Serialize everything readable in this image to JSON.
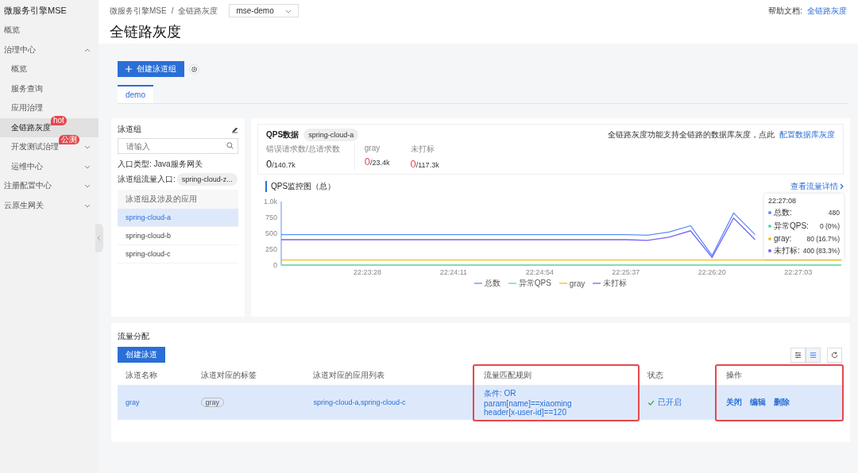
{
  "sidebar": {
    "title": "微服务引擎MSE",
    "items": [
      {
        "label": "概览",
        "selected": false
      },
      {
        "label": "治理中心",
        "selected": false,
        "expanded": true,
        "children": [
          {
            "label": "概览",
            "selected": false
          },
          {
            "label": "服务查询",
            "selected": false
          },
          {
            "label": "应用治理",
            "selected": false
          },
          {
            "label": "全链路灰度",
            "selected": true,
            "badge": "hot"
          },
          {
            "label": "开发测试治理",
            "selected": false,
            "badge": "公测",
            "expanded": false
          },
          {
            "label": "运维中心",
            "selected": false,
            "expanded": false
          }
        ]
      },
      {
        "label": "注册配置中心",
        "selected": false,
        "expanded": false
      },
      {
        "label": "云原生网关",
        "selected": false,
        "expanded": false
      }
    ]
  },
  "breadcrumb": {
    "items": [
      "微服务引擎MSE",
      "全链路灰度"
    ],
    "separator": "/"
  },
  "instance_select": {
    "value": "mse-demo"
  },
  "help": {
    "label": "帮助文档:",
    "link": "全链路灰度"
  },
  "page_title": "全链路灰度",
  "create_group_button": "创建泳道组",
  "tabs": [
    {
      "label": "demo",
      "selected": true
    }
  ],
  "lane_group": {
    "title": "泳道组",
    "search": {
      "placeholder": "请输入"
    },
    "entry_type": "入口类型: Java服务网关",
    "entry_label": "泳道组流量入口:",
    "entry_value": "spring-cloud-z...",
    "apps_header": "泳道组及涉及的应用",
    "apps": [
      {
        "label": "spring-cloud-a",
        "selected": true
      },
      {
        "label": "spring-cloud-b",
        "selected": false
      },
      {
        "label": "spring-cloud-c",
        "selected": false
      }
    ]
  },
  "qps": {
    "title": "QPS数据",
    "app": "spring-cloud-a",
    "notice": "全链路灰度功能支持全链路的数据库灰度，点此",
    "notice_link": "配置数据库灰度",
    "stats": [
      {
        "label": "错误请求数/总请求数",
        "value": "0",
        "total": "/140.7k",
        "alert": false
      },
      {
        "label": "gray",
        "value": "0",
        "total": "/23.4k",
        "alert": true
      },
      {
        "label": "未打标",
        "value": "0",
        "total": "/117.3k",
        "alert": true
      }
    ]
  },
  "monitor": {
    "title": "QPS监控图（总）",
    "detail_link": "查看流量详情",
    "chart_data": {
      "type": "line",
      "categories": [
        null,
        null,
        null,
        null,
        "22:23:28",
        null,
        null,
        null,
        "22:24:11",
        null,
        null,
        null,
        "22:24:54",
        null,
        null,
        null,
        "22:25:37",
        null,
        null,
        null,
        "22:26:20",
        null,
        null,
        null,
        "22:27:03",
        null,
        null
      ],
      "ylim": [
        0,
        1000
      ],
      "legend": true,
      "yticks": [
        0,
        250,
        500,
        750,
        {
          "value": 1000,
          "label": "1.0k"
        }
      ],
      "series": [
        {
          "name": "总数",
          "color": "#5b8ff9",
          "values": [
            480,
            480,
            480,
            480,
            480,
            480,
            480,
            480,
            480,
            480,
            480,
            480,
            480,
            480,
            480,
            480,
            480,
            470,
            520,
            620,
            150,
            820,
            480,
            null,
            null,
            null,
            null
          ]
        },
        {
          "name": "异常QPS",
          "color": "#5ad8a6",
          "values": [
            0,
            0,
            0,
            0,
            0,
            0,
            0,
            0,
            0,
            0,
            0,
            0,
            0,
            0,
            0,
            0,
            0,
            0,
            0,
            0,
            0,
            0,
            0,
            0,
            0,
            0,
            0
          ]
        },
        {
          "name": "gray",
          "color": "#f6bd16",
          "values": [
            80,
            80,
            80,
            80,
            80,
            80,
            80,
            80,
            80,
            80,
            80,
            80,
            80,
            80,
            80,
            80,
            80,
            80,
            80,
            80,
            80,
            80,
            80,
            80,
            80,
            80,
            80
          ]
        },
        {
          "name": "未打标",
          "color": "#7262fd",
          "values": [
            400,
            400,
            400,
            400,
            400,
            400,
            400,
            400,
            400,
            400,
            400,
            400,
            400,
            400,
            400,
            400,
            400,
            390,
            440,
            540,
            120,
            740,
            400,
            null,
            null,
            null,
            null
          ]
        }
      ]
    },
    "tooltip": {
      "time": "22:27:08",
      "rows": [
        {
          "label": "总数:",
          "value": "480",
          "color": "#5b8ff9"
        },
        {
          "label": "异常QPS:",
          "value": "0 (0%)",
          "color": "#5ad8a6"
        },
        {
          "label": "gray:",
          "value": "80 (16.7%)",
          "color": "#f6bd16"
        },
        {
          "label": "未打标:",
          "value": "400 (83.3%)",
          "color": "#7262fd"
        }
      ]
    }
  },
  "traffic": {
    "title": "流量分配",
    "create_button": "创建泳道",
    "columns": [
      {
        "label": "泳道名称",
        "highlighted": false
      },
      {
        "label": "泳道对应的标签",
        "highlighted": false
      },
      {
        "label": "泳道对应的应用列表",
        "highlighted": false
      },
      {
        "label": "流量匹配规则",
        "highlighted": true
      },
      {
        "label": "状态",
        "highlighted": false
      },
      {
        "label": "操作",
        "highlighted": true
      }
    ],
    "rows": [
      {
        "name": "gray",
        "tag": "gray",
        "apps": "spring-cloud-a,spring-cloud-c",
        "rules": [
          "条件: OR",
          "param[name]==xiaoming",
          "header[x-user-id]==120"
        ],
        "status": "已开启",
        "enabled": true,
        "actions": [
          "关闭",
          "编辑",
          "删除"
        ],
        "selected": true
      }
    ]
  }
}
